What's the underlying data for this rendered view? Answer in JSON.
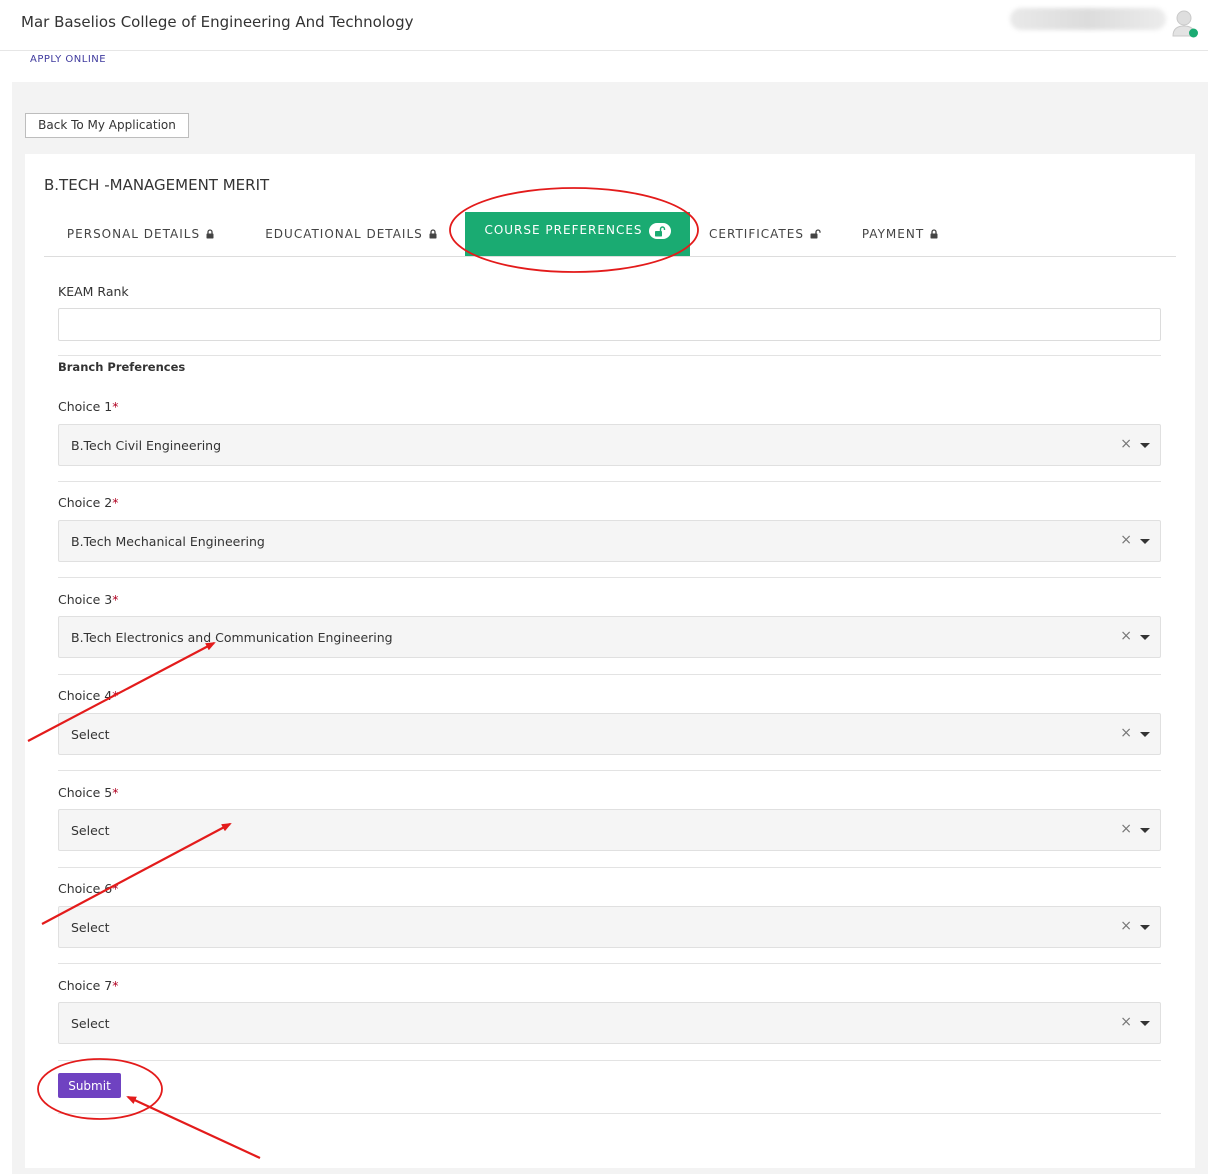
{
  "header": {
    "college_name": "Mar Baselios College of Engineering And Technology",
    "apply_link": "APPLY ONLINE",
    "avatar_icon": "user-avatar-icon",
    "status_color": "#1aab72"
  },
  "back_button": {
    "label": "Back To My Application"
  },
  "course": {
    "title": "B.TECH -MANAGEMENT MERIT"
  },
  "tabs": [
    {
      "label": "PERSONAL DETAILS",
      "icon": "lock-icon",
      "active": false
    },
    {
      "label": "EDUCATIONAL DETAILS",
      "icon": "lock-icon",
      "active": false
    },
    {
      "label": "COURSE PREFERENCES",
      "icon": "unlock-icon",
      "active": true
    },
    {
      "label": "CERTIFICATES",
      "icon": "unlock-icon",
      "active": false
    },
    {
      "label": "PAYMENT",
      "icon": "lock-icon",
      "active": false
    }
  ],
  "form": {
    "keam": {
      "label": "KEAM Rank",
      "value": ""
    },
    "section_title": "Branch Preferences",
    "required_mark": "*",
    "choices": [
      {
        "label": "Choice 1",
        "value": "B.Tech Civil Engineering"
      },
      {
        "label": "Choice 2",
        "value": "B.Tech Mechanical Engineering"
      },
      {
        "label": "Choice 3",
        "value": "B.Tech Electronics and Communication Engineering"
      },
      {
        "label": "Choice 4",
        "value": "Select"
      },
      {
        "label": "Choice 5",
        "value": "Select"
      },
      {
        "label": "Choice 6",
        "value": "Select"
      },
      {
        "label": "Choice 7",
        "value": "Select"
      }
    ],
    "clear_glyph": "×",
    "submit_label": "Submit"
  },
  "colors": {
    "active_tab": "#1aab72",
    "submit": "#6f42c1",
    "annotation": "#e31b1b"
  }
}
